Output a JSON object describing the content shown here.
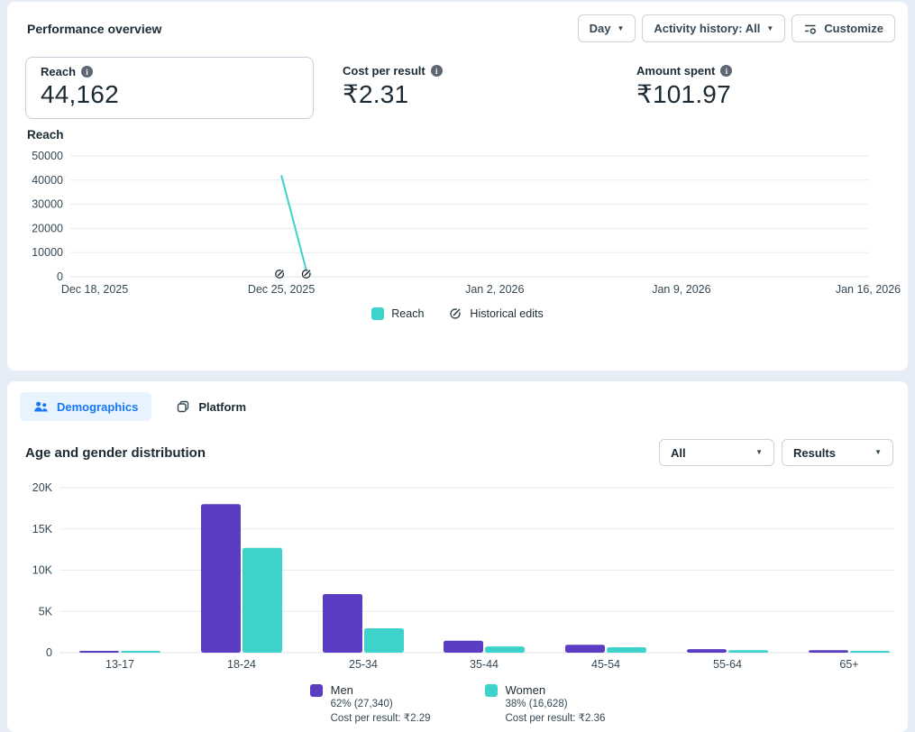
{
  "performance": {
    "title": "Performance overview",
    "controls": {
      "granularity": "Day",
      "activity_history": "Activity history: All",
      "customize": "Customize"
    },
    "metrics": [
      {
        "label": "Reach",
        "value": "44,162",
        "selected": true
      },
      {
        "label": "Cost per result",
        "value": "₹2.31",
        "selected": false
      },
      {
        "label": "Amount spent",
        "value": "₹101.97",
        "selected": false
      }
    ],
    "chart_title": "Reach",
    "legend_edits": "Historical edits"
  },
  "demographics": {
    "tabs": [
      {
        "label": "Demographics",
        "active": true
      },
      {
        "label": "Platform",
        "active": false
      }
    ],
    "heading": "Age and gender distribution",
    "filters": {
      "breakdown": "All",
      "metric": "Results"
    },
    "legend": [
      {
        "name": "Men",
        "share": "62% (27,340)",
        "cost": "Cost per result: ₹2.29",
        "color": "#5a3dc2"
      },
      {
        "name": "Women",
        "share": "38% (16,628)",
        "cost": "Cost per result: ₹2.36",
        "color": "#3dd2cb"
      }
    ]
  },
  "chart_data": [
    {
      "type": "line",
      "title": "Reach",
      "ylabel": "Reach",
      "y_ticks": [
        0,
        10000,
        20000,
        30000,
        40000,
        50000
      ],
      "ylim": [
        0,
        50000
      ],
      "x_ticks": [
        {
          "label": "Dec 18, 2025",
          "day_offset": 0
        },
        {
          "label": "Dec 25, 2025",
          "day_offset": 7
        },
        {
          "label": "Jan 2, 2026",
          "day_offset": 15
        },
        {
          "label": "Jan 9, 2026",
          "day_offset": 22
        },
        {
          "label": "Jan 16, 2026",
          "day_offset": 29
        }
      ],
      "x_span_days": 29,
      "grid": true,
      "legend_position": "bottom",
      "series": [
        {
          "name": "Reach",
          "color": "#3dd2cb",
          "points": [
            {
              "date": "Dec 25, 2025",
              "day_offset": 7,
              "value": 42000
            },
            {
              "date": "Dec 26, 2025",
              "day_offset": 8,
              "value": 0
            }
          ]
        }
      ],
      "historical_edits": [
        {
          "date": "Dec 25, 2025",
          "day_offset": 7
        },
        {
          "date": "Dec 26, 2025",
          "day_offset": 8
        }
      ]
    },
    {
      "type": "bar",
      "title": "Age and gender distribution",
      "categories": [
        "13-17",
        "18-24",
        "25-34",
        "35-44",
        "45-54",
        "55-64",
        "65+"
      ],
      "series": [
        {
          "name": "Men",
          "color": "#5a3dc2",
          "values": [
            150,
            18000,
            7100,
            1450,
            950,
            420,
            300
          ]
        },
        {
          "name": "Women",
          "color": "#3dd2cb",
          "values": [
            120,
            12700,
            2950,
            750,
            650,
            300,
            220
          ]
        }
      ],
      "y_ticks": [
        "0",
        "5K",
        "10K",
        "15K",
        "20K"
      ],
      "ylim": [
        0,
        20000
      ],
      "grid": true,
      "legend_position": "bottom"
    }
  ],
  "colors": {
    "accent_blue": "#1877f2",
    "tab_active_bg": "#e7f3ff",
    "men_purple": "#5a3dc2",
    "women_teal": "#3dd2cb",
    "text_dark": "#1c2b33",
    "text_secondary": "#344854",
    "gridline": "#e8eaee",
    "page_bg": "#e6edf6"
  }
}
